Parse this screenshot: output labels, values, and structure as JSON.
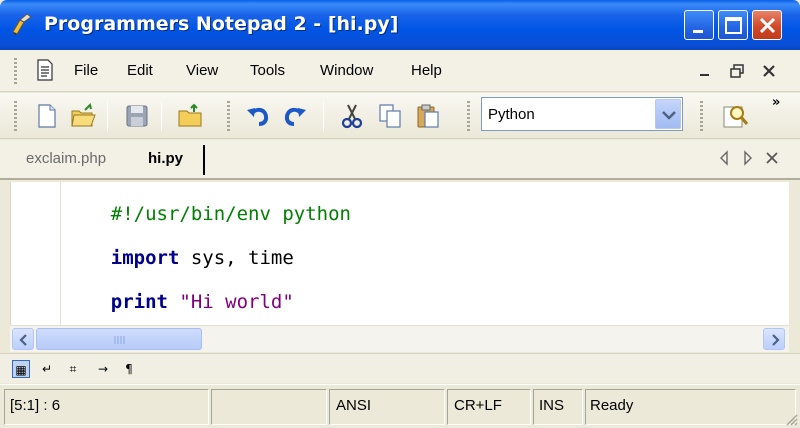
{
  "window": {
    "title": "Programmers Notepad 2 - [hi.py]"
  },
  "menu": {
    "items": [
      "File",
      "Edit",
      "View",
      "Tools",
      "Window",
      "Help"
    ]
  },
  "toolbar": {
    "scheme_value": "Python",
    "overflow": "»"
  },
  "tabs": [
    {
      "label": "exclaim.php",
      "active": false
    },
    {
      "label": "hi.py",
      "active": true
    }
  ],
  "editor": {
    "lines": [
      {
        "segments": [
          {
            "text": "#!/usr/bin/env python",
            "kind": "comment"
          }
        ]
      },
      {
        "segments": [
          {
            "text": "import",
            "kind": "keyword"
          },
          {
            "text": " sys, time",
            "kind": "plain"
          }
        ]
      },
      {
        "segments": [
          {
            "text": "print",
            "kind": "keyword"
          },
          {
            "text": " ",
            "kind": "plain"
          },
          {
            "text": "\"Hi world\"",
            "kind": "string"
          }
        ]
      }
    ]
  },
  "viewbar": {
    "buttons": [
      "▦",
      "↵",
      "⌗",
      "→",
      "¶"
    ]
  },
  "status": {
    "position": "[5:1] : 6",
    "encoding": "ANSI",
    "line_endings": "CR+LF",
    "mode": "INS",
    "state": "Ready"
  },
  "colors": {
    "title_bar": "#0055e5",
    "comment": "#008000",
    "keyword": "#00008b",
    "string": "#800080"
  },
  "icons": [
    "app-icon",
    "minimize-icon",
    "maximize-icon",
    "close-icon",
    "document-icon",
    "new-file-icon",
    "open-file-icon",
    "save-icon",
    "open-folder-icon",
    "undo-icon",
    "redo-icon",
    "cut-icon",
    "copy-icon",
    "paste-icon",
    "find-icon"
  ]
}
